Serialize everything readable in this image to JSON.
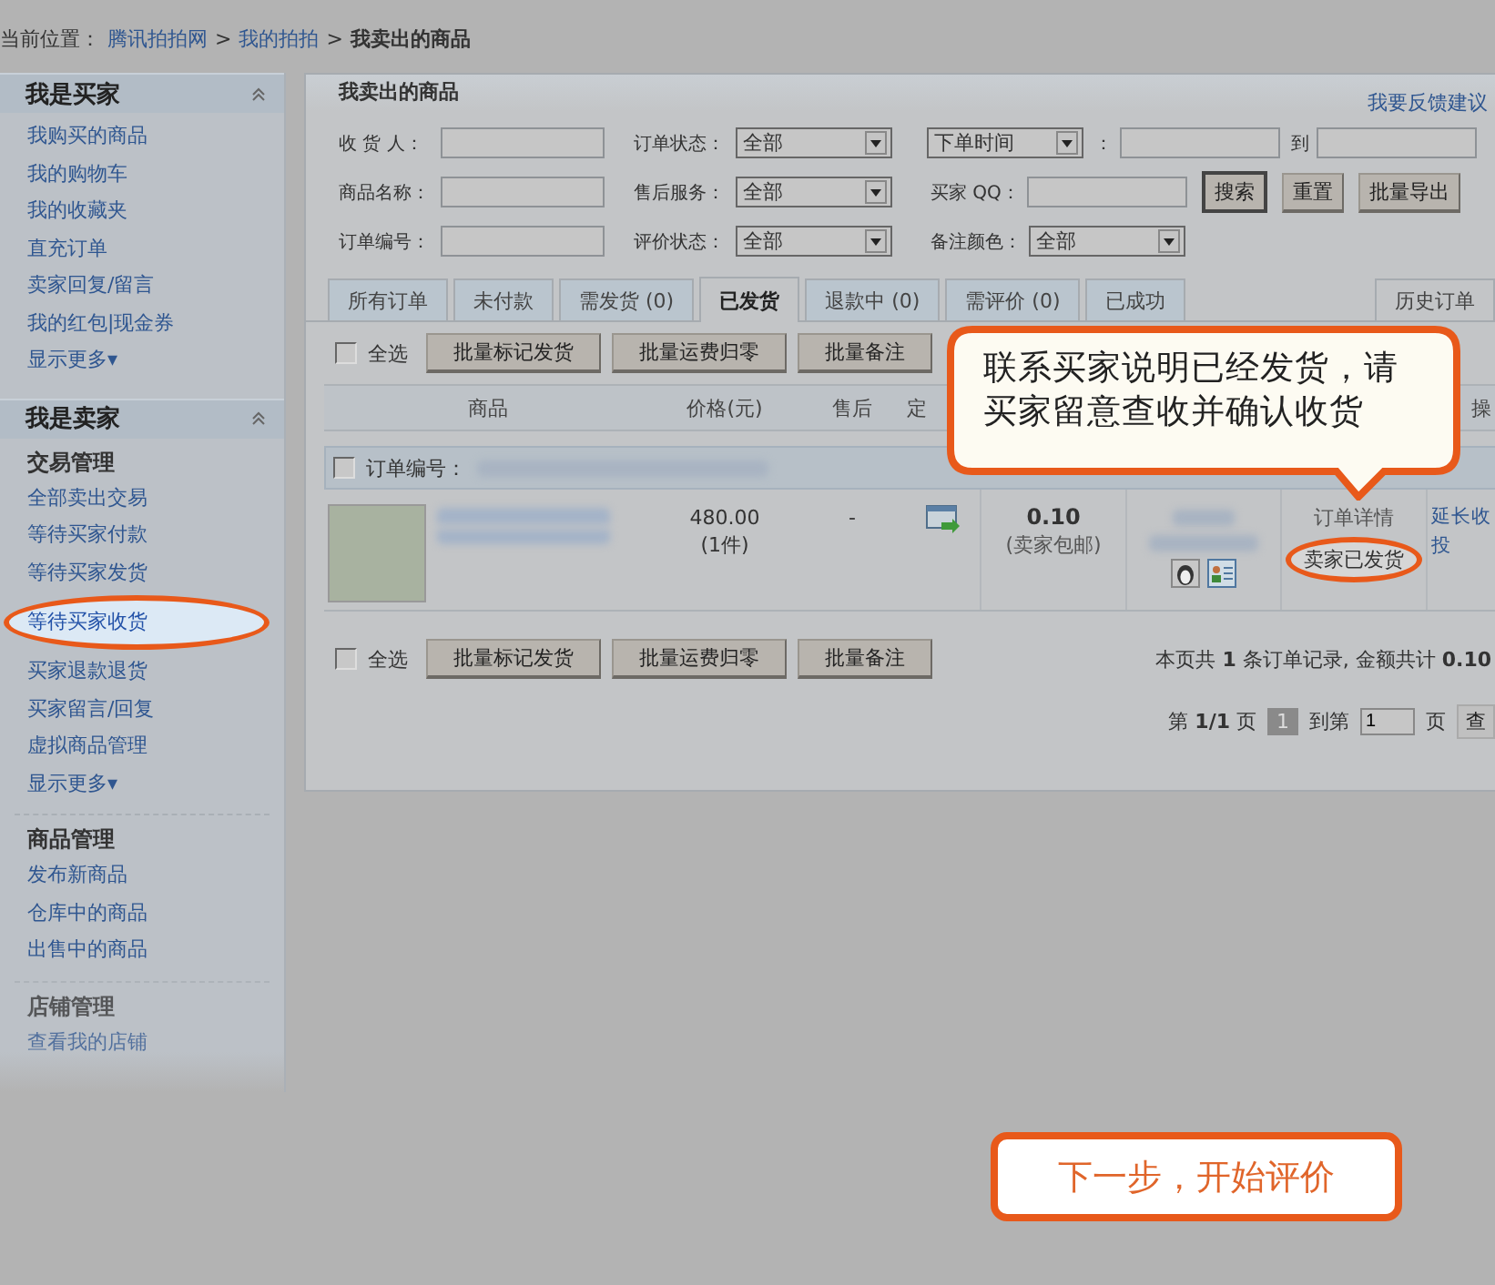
{
  "breadcrumb": {
    "label": "当前位置：",
    "crumbs": [
      {
        "text": "腾讯拍拍网",
        "kind": "link"
      },
      {
        "text": "我的拍拍",
        "kind": "link",
        "separator": ">"
      },
      {
        "text": "我卖出的商品",
        "kind": "current",
        "separator": ">"
      }
    ]
  },
  "sidebar": {
    "sections": [
      {
        "title": "我是买家",
        "groups": [
          {
            "items": [
              {
                "label": "我购买的商品",
                "selected": false
              },
              {
                "label": "我的购物车",
                "selected": false
              },
              {
                "label": "我的收藏夹",
                "selected": false
              },
              {
                "label": "直充订单",
                "selected": false
              },
              {
                "label": "卖家回复/留言",
                "selected": false
              },
              {
                "label": "我的红包|现金券",
                "selected": false
              },
              {
                "label": "显示更多▾",
                "selected": false
              }
            ]
          }
        ]
      },
      {
        "title": "我是卖家",
        "groups": [
          {
            "heading": "交易管理",
            "faded": false,
            "items": [
              {
                "label": "全部卖出交易",
                "selected": false
              },
              {
                "label": "等待买家付款",
                "selected": false
              },
              {
                "label": "等待买家发货",
                "selected": false
              },
              {
                "label": "等待买家收货",
                "selected": true
              },
              {
                "label": "买家退款退货",
                "selected": false
              },
              {
                "label": "买家留言/回复",
                "selected": false
              },
              {
                "label": "虚拟商品管理",
                "selected": false
              },
              {
                "label": "显示更多▾",
                "selected": false
              }
            ]
          },
          {
            "heading": "商品管理",
            "faded": false,
            "items": [
              {
                "label": "发布新商品",
                "selected": false
              },
              {
                "label": "仓库中的商品",
                "selected": false
              },
              {
                "label": "出售中的商品",
                "selected": false
              }
            ]
          },
          {
            "heading": "店铺管理",
            "faded": true,
            "items": [
              {
                "label": "查看我的店铺",
                "selected": false
              }
            ]
          }
        ]
      }
    ]
  },
  "main": {
    "title": "我卖出的商品",
    "feedback_link": "我要反馈建议",
    "filters": [
      [
        {
          "kind": "text",
          "label": "收 货 人："
        },
        {
          "kind": "select",
          "label": "订单状态：",
          "value": "全部"
        },
        {
          "kind": "select",
          "value": "下单时间"
        },
        {
          "kind": "text",
          "label": "："
        },
        {
          "kind": "text",
          "label": "到"
        }
      ],
      [
        {
          "kind": "text",
          "label": "商品名称："
        },
        {
          "kind": "select",
          "label": "售后服务：",
          "value": "全部"
        },
        {
          "kind": "text",
          "label": "买家 QQ："
        },
        {
          "kind": "button",
          "label": "搜索",
          "focused": true
        },
        {
          "kind": "button",
          "label": "重置",
          "focused": false
        },
        {
          "kind": "button",
          "label": "批量导出",
          "focused": false
        }
      ],
      [
        {
          "kind": "text",
          "label": "订单编号："
        },
        {
          "kind": "select",
          "label": "评价状态：",
          "value": "全部"
        },
        {
          "kind": "select",
          "label": "备注颜色：",
          "value": "全部"
        }
      ]
    ],
    "tabs": [
      {
        "label": "所有订单",
        "selected": false
      },
      {
        "label": "未付款",
        "selected": false
      },
      {
        "label": "需发货 (0)",
        "selected": false
      },
      {
        "label": "已发货",
        "selected": true
      },
      {
        "label": "退款中 (0)",
        "selected": false
      },
      {
        "label": "需评价 (0)",
        "selected": false
      },
      {
        "label": "已成功",
        "selected": false
      }
    ],
    "history_tab": "历史订单",
    "toolbar": {
      "select_all": {
        "label": "全选",
        "checked": false
      },
      "buttons": [
        "批量标记发货",
        "批量运费归零",
        "批量备注"
      ]
    },
    "table": {
      "columns": [
        "商品",
        "价格(元)",
        "售后",
        "定",
        "操"
      ],
      "orders": [
        {
          "checked": false,
          "number_label": "订单编号：",
          "items": [
            {
              "price": "480.00",
              "quantity": "(1件)",
              "after_sales": "-",
              "shipping_fee": "0.10",
              "shipping_note": "(卖家包邮)",
              "detail_link": "订单详情",
              "status": "卖家已发货",
              "actions": [
                "延长收",
                "投"
              ]
            }
          ]
        }
      ]
    },
    "footer": {
      "select_all": {
        "label": "全选",
        "checked": false
      },
      "buttons": [
        "批量标记发货",
        "批量运费归零",
        "批量备注"
      ],
      "summary": "本页共 **1** 条订单记录, 金额共计 **0.10**"
    },
    "pagination": {
      "text": "第 **1/1** 页",
      "pages": [
        {
          "label": "1",
          "selected": true
        }
      ],
      "goto_label": "到第",
      "goto_value": "1",
      "goto_suffix": "页",
      "button": "查"
    }
  },
  "callout": {
    "text": "联系买家说明已经发货，请买家留意查收并确认收货"
  },
  "next_button": "下一步，开始评价"
}
